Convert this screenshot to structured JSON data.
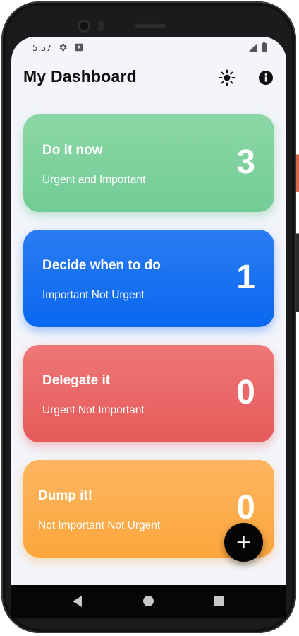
{
  "status_bar": {
    "time": "5:57",
    "icons": [
      "gear-icon",
      "a-notification-icon",
      "signal-icon",
      "battery-icon"
    ]
  },
  "app_bar": {
    "title": "My Dashboard",
    "actions": [
      "brightness-icon",
      "info-icon"
    ]
  },
  "cards": [
    {
      "title": "Do it now",
      "subtitle": "Urgent and Important",
      "count": "3",
      "color": "#7fd19e"
    },
    {
      "title": "Decide when to do",
      "subtitle": "Important Not Urgent",
      "count": "1",
      "color": "#1a72f2"
    },
    {
      "title": "Delegate it",
      "subtitle": "Urgent Not Important",
      "count": "0",
      "color": "#ea6868"
    },
    {
      "title": "Dump it!",
      "subtitle": "Not Important Not Urgent",
      "count": "0",
      "color": "#fdae4e"
    }
  ],
  "fab": {
    "label": "+",
    "icon": "plus-icon"
  },
  "nav_bar": [
    "back-icon",
    "home-icon",
    "recents-icon"
  ]
}
